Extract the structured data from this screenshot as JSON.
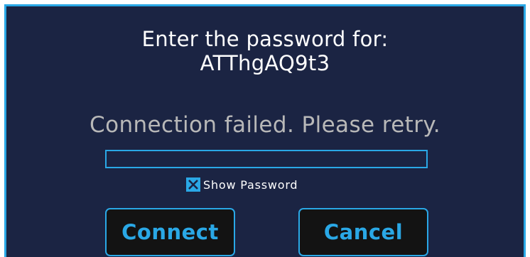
{
  "dialog": {
    "title_line1": "Enter the password for:",
    "network_name": "ATThgAQ9t3",
    "status_message": "Connection failed. Please retry.",
    "password_value": "",
    "show_password_label": "Show Password",
    "show_password_checked": true,
    "connect_label": "Connect",
    "cancel_label": "Cancel"
  },
  "colors": {
    "background": "#1b2443",
    "accent": "#2aa8e6",
    "button_bg": "#131313",
    "status_text": "#b8b8b8",
    "title_text": "#ffffff"
  },
  "icons": {
    "checkbox": "checkbox-checked-icon"
  }
}
